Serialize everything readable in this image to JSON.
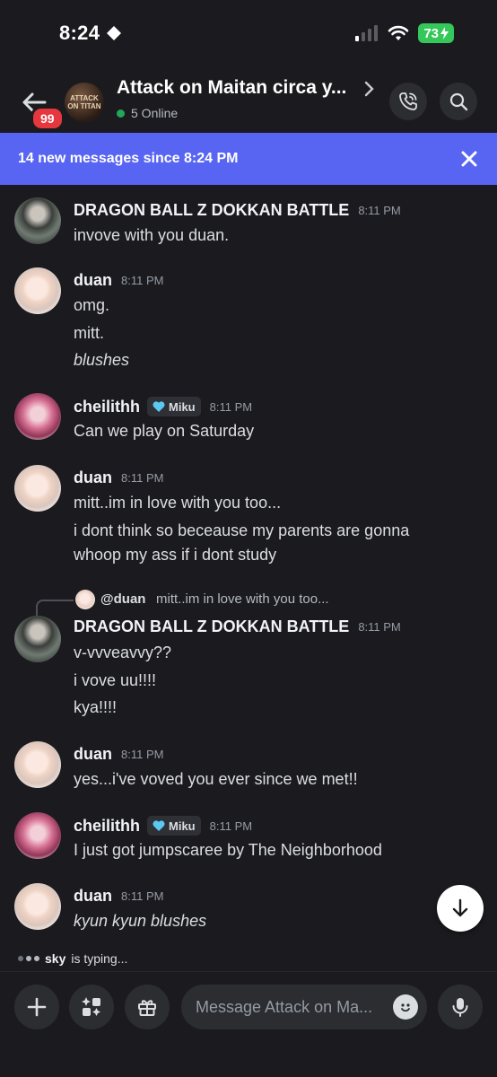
{
  "status_bar": {
    "time": "8:24",
    "battery": "73"
  },
  "header": {
    "unread_badge": "99",
    "server_avatar_text": "ATTACK ON TITAN",
    "channel_title": "Attack on Maitan circa y...",
    "online_count": "5 Online"
  },
  "banner": {
    "text": "14 new messages since 8:24 PM"
  },
  "messages": [
    {
      "author": "DRAGON BALL Z DOKKAN BATTLE",
      "time": "8:11 PM",
      "lines": [
        "invove with you duan."
      ]
    },
    {
      "author": "duan",
      "time": "8:11 PM",
      "lines": [
        "omg.",
        "mitt.",
        "blushes"
      ]
    },
    {
      "author": "cheilithh",
      "tag": "Miku",
      "time": "8:11 PM",
      "lines": [
        "Can we play on Saturday"
      ]
    },
    {
      "author": "duan",
      "time": "8:11 PM",
      "lines": [
        "mitt..im in love with you too...",
        "i dont think so beceause my parents are gonna",
        "whoop my ass if i dont study"
      ]
    },
    {
      "reply_to": {
        "name": "@duan",
        "text": "mitt..im in love with you too..."
      },
      "author": "DRAGON BALL Z DOKKAN BATTLE",
      "time": "8:11 PM",
      "lines": [
        "v-vvveavvy??",
        "i vove uu!!!!",
        "kya!!!!"
      ]
    },
    {
      "author": "duan",
      "time": "8:11 PM",
      "lines": [
        "yes...i've voved you ever since we met!!"
      ]
    },
    {
      "author": "cheilithh",
      "tag": "Miku",
      "time": "8:11 PM",
      "lines": [
        "I just got jumpscaree by The Neighborhood"
      ]
    },
    {
      "author": "duan",
      "time": "8:11 PM",
      "lines": [
        "kyun kyun blushes"
      ]
    }
  ],
  "typing": {
    "user": "sky",
    "suffix": "is typing..."
  },
  "composer": {
    "placeholder": "Message Attack on Ma..."
  },
  "colors": {
    "background": "#1b1b1f",
    "banner": "#5865f2",
    "online": "#23a55a",
    "badge": "#e5373d",
    "battery": "#34c759"
  },
  "icons": [
    "back-arrow-icon",
    "phone-icon",
    "search-icon",
    "close-icon",
    "arrow-down-icon",
    "plus-icon",
    "apps-icon",
    "gift-icon",
    "emoji-icon",
    "microphone-icon",
    "wifi-icon",
    "signal-icon",
    "heart-icon"
  ]
}
